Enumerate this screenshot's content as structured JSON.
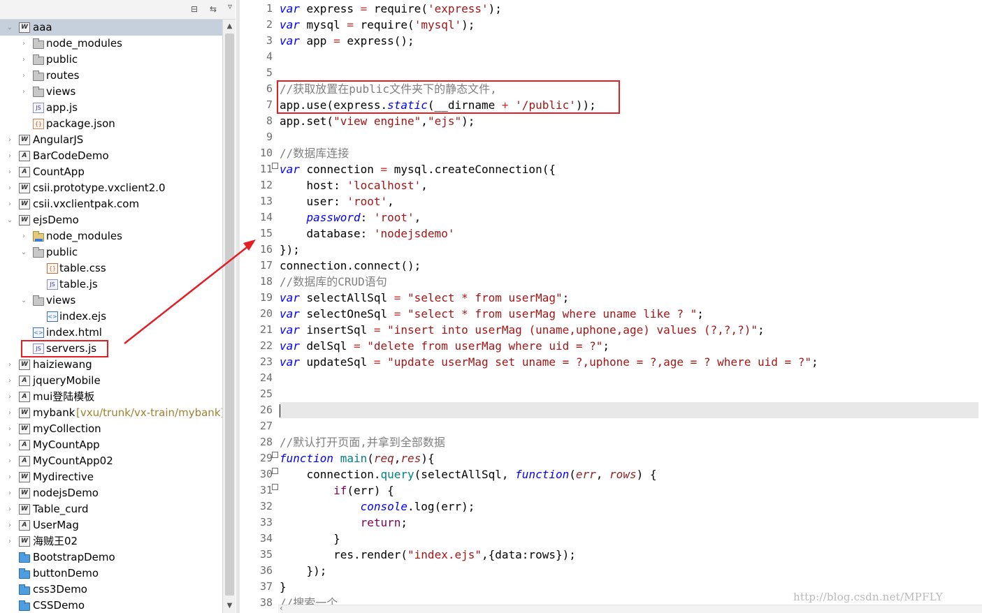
{
  "explorer": {
    "toolbar": {
      "collapse_icon": "collapse-all-icon",
      "link_icon": "link-editor-icon",
      "menu_icon": "view-menu-icon"
    },
    "items": [
      {
        "label": "aaa",
        "icon": "web-project-icon",
        "kind": "proj",
        "glyph": "W",
        "twisty": "▾",
        "level": 0,
        "selected": true
      },
      {
        "label": "node_modules",
        "icon": "folder-icon",
        "kind": "folder",
        "twisty": "›",
        "level": 1
      },
      {
        "label": "public",
        "icon": "folder-icon",
        "kind": "folder",
        "twisty": "›",
        "level": 1
      },
      {
        "label": "routes",
        "icon": "folder-icon",
        "kind": "folder",
        "twisty": "›",
        "level": 1
      },
      {
        "label": "views",
        "icon": "folder-icon",
        "kind": "folder",
        "twisty": "›",
        "level": 1
      },
      {
        "label": "app.js",
        "icon": "js-file-icon",
        "kind": "file",
        "glyph": "JS",
        "level": 1
      },
      {
        "label": "package.json",
        "icon": "json-file-icon",
        "kind": "file-json",
        "glyph": "{}",
        "level": 1
      },
      {
        "label": "AngularJS",
        "icon": "web-project-icon",
        "kind": "proj",
        "glyph": "W",
        "twisty": "›",
        "level": 0
      },
      {
        "label": "BarCodeDemo",
        "icon": "app-project-icon",
        "kind": "proj",
        "glyph": "A",
        "twisty": "›",
        "level": 0
      },
      {
        "label": "CountApp",
        "icon": "app-project-icon",
        "kind": "proj",
        "glyph": "A",
        "twisty": "›",
        "level": 0
      },
      {
        "label": "csii.prototype.vxclient2.0",
        "icon": "web-project-icon",
        "kind": "proj",
        "glyph": "W",
        "twisty": "›",
        "level": 0
      },
      {
        "label": "csii.vxclientpak.com",
        "icon": "web-project-icon",
        "kind": "proj",
        "glyph": "W",
        "twisty": "›",
        "level": 0
      },
      {
        "label": "ejsDemo",
        "icon": "web-project-icon",
        "kind": "proj",
        "glyph": "W",
        "twisty": "▾",
        "level": 0
      },
      {
        "label": "node_modules",
        "icon": "library-folder-icon",
        "kind": "folder-lib",
        "twisty": "›",
        "level": 1
      },
      {
        "label": "public",
        "icon": "open-folder-icon",
        "kind": "folder-open",
        "twisty": "▾",
        "level": 1
      },
      {
        "label": "table.css",
        "icon": "css-file-icon",
        "kind": "file-css",
        "glyph": "{}",
        "level": 2
      },
      {
        "label": "table.js",
        "icon": "js-file-icon",
        "kind": "file",
        "glyph": "JS",
        "level": 2
      },
      {
        "label": "views",
        "icon": "open-folder-icon",
        "kind": "folder-open",
        "twisty": "▾",
        "level": 1
      },
      {
        "label": "index.ejs",
        "icon": "ejs-file-icon",
        "kind": "file-ejs",
        "glyph": "<>",
        "level": 2
      },
      {
        "label": "index.html",
        "icon": "html-file-icon",
        "kind": "file-html",
        "glyph": "<>",
        "level": 1
      },
      {
        "label": "servers.js",
        "icon": "js-file-icon",
        "kind": "file",
        "glyph": "JS",
        "level": 1,
        "highlight": true
      },
      {
        "label": "haiziewang",
        "icon": "web-project-icon",
        "kind": "proj",
        "glyph": "W",
        "twisty": "›",
        "level": 0
      },
      {
        "label": "jqueryMobile",
        "icon": "app-project-icon",
        "kind": "proj",
        "glyph": "A",
        "twisty": "›",
        "level": 0
      },
      {
        "label": "mui登陆模板",
        "icon": "app-project-icon",
        "kind": "proj",
        "glyph": "A",
        "twisty": "›",
        "level": 0
      },
      {
        "label": "mybank",
        "decoration": "[vxu/trunk/vx-train/mybank]",
        "icon": "svn-project-icon",
        "kind": "proj",
        "glyph": "W",
        "twisty": "›",
        "level": 0
      },
      {
        "label": "myCollection",
        "icon": "web-project-icon",
        "kind": "proj",
        "glyph": "W",
        "twisty": "›",
        "level": 0
      },
      {
        "label": "MyCountApp",
        "icon": "app-project-icon",
        "kind": "proj",
        "glyph": "A",
        "twisty": "›",
        "level": 0
      },
      {
        "label": "MyCountApp02",
        "icon": "app-project-icon",
        "kind": "proj",
        "glyph": "A",
        "twisty": "›",
        "level": 0
      },
      {
        "label": "Mydirective",
        "icon": "web-project-icon",
        "kind": "proj",
        "glyph": "W",
        "twisty": "›",
        "level": 0
      },
      {
        "label": "nodejsDemo",
        "icon": "web-project-icon",
        "kind": "proj",
        "glyph": "W",
        "twisty": "›",
        "level": 0
      },
      {
        "label": "Table_curd",
        "icon": "web-project-icon",
        "kind": "proj",
        "glyph": "W",
        "twisty": "›",
        "level": 0
      },
      {
        "label": "UserMag",
        "icon": "app-project-icon",
        "kind": "proj",
        "glyph": "A",
        "twisty": "›",
        "level": 0
      },
      {
        "label": "海贼王02",
        "icon": "web-project-icon",
        "kind": "proj",
        "glyph": "W",
        "twisty": "›",
        "level": 0
      },
      {
        "label": "BootstrapDemo",
        "icon": "blue-folder-icon",
        "kind": "folder-blue",
        "level": 0
      },
      {
        "label": "buttonDemo",
        "icon": "blue-folder-icon",
        "kind": "folder-blue",
        "level": 0
      },
      {
        "label": "css3Demo",
        "icon": "blue-folder-icon",
        "kind": "folder-blue",
        "level": 0
      },
      {
        "label": "CSSDemo",
        "icon": "blue-folder-icon",
        "kind": "folder-blue",
        "level": 0
      }
    ],
    "scroll": {
      "up_icon": "scroll-up-icon",
      "down_icon": "scroll-down-icon"
    }
  },
  "editor": {
    "lines": [
      {
        "n": "1",
        "tokens": [
          [
            "k",
            "var"
          ],
          [
            "m",
            " express "
          ],
          [
            "o",
            "="
          ],
          [
            "m",
            " require("
          ],
          [
            "s",
            "'express'"
          ],
          [
            "m",
            ");"
          ]
        ]
      },
      {
        "n": "2",
        "tokens": [
          [
            "k",
            "var"
          ],
          [
            "m",
            " mysql "
          ],
          [
            "o",
            "="
          ],
          [
            "m",
            " require("
          ],
          [
            "s",
            "'mysql'"
          ],
          [
            "m",
            ");"
          ]
        ]
      },
      {
        "n": "3",
        "tokens": [
          [
            "k",
            "var"
          ],
          [
            "m",
            " app "
          ],
          [
            "o",
            "="
          ],
          [
            "m",
            " express();"
          ]
        ]
      },
      {
        "n": "4",
        "tokens": []
      },
      {
        "n": "5",
        "tokens": []
      },
      {
        "n": "6",
        "tokens": [
          [
            "c",
            "//获取放置在public文件夹下的静态文件,"
          ]
        ]
      },
      {
        "n": "7",
        "tokens": [
          [
            "m",
            "app.use(express."
          ],
          [
            "prop-i",
            "static"
          ],
          [
            "m",
            "(__dirname "
          ],
          [
            "o",
            "+"
          ],
          [
            "m",
            " "
          ],
          [
            "s",
            "'/public'"
          ],
          [
            "m",
            "));"
          ]
        ]
      },
      {
        "n": "8",
        "tokens": [
          [
            "m",
            "app.set("
          ],
          [
            "s",
            "\"view engine\""
          ],
          [
            "m",
            ","
          ],
          [
            "s",
            "\"ejs\""
          ],
          [
            "m",
            ");"
          ]
        ]
      },
      {
        "n": "9",
        "tokens": []
      },
      {
        "n": "10",
        "tokens": [
          [
            "c",
            "//数据库连接"
          ]
        ]
      },
      {
        "n": "11",
        "fold": true,
        "tokens": [
          [
            "k",
            "var"
          ],
          [
            "m",
            " connection "
          ],
          [
            "o",
            "="
          ],
          [
            "m",
            " mysql.createConnection({"
          ]
        ]
      },
      {
        "n": "12",
        "tokens": [
          [
            "m",
            "    host: "
          ],
          [
            "s",
            "'localhost'"
          ],
          [
            "m",
            ","
          ]
        ]
      },
      {
        "n": "13",
        "tokens": [
          [
            "m",
            "    user: "
          ],
          [
            "s",
            "'root'"
          ],
          [
            "m",
            ","
          ]
        ]
      },
      {
        "n": "14",
        "tokens": [
          [
            "m",
            "    "
          ],
          [
            "prop-i",
            "password"
          ],
          [
            "m",
            ": "
          ],
          [
            "s",
            "'root'"
          ],
          [
            "m",
            ","
          ]
        ]
      },
      {
        "n": "15",
        "tokens": [
          [
            "m",
            "    database: "
          ],
          [
            "s",
            "'nodejsdemo'"
          ]
        ]
      },
      {
        "n": "16",
        "tokens": [
          [
            "m",
            "});"
          ]
        ]
      },
      {
        "n": "17",
        "tokens": [
          [
            "m",
            "connection.connect();"
          ]
        ]
      },
      {
        "n": "18",
        "tokens": [
          [
            "c",
            "//数据库的CRUD语句"
          ]
        ]
      },
      {
        "n": "19",
        "tokens": [
          [
            "k",
            "var"
          ],
          [
            "m",
            " selectAllSql "
          ],
          [
            "o",
            "="
          ],
          [
            "m",
            " "
          ],
          [
            "s",
            "\"select * from userMag\""
          ],
          [
            "m",
            ";"
          ]
        ]
      },
      {
        "n": "20",
        "tokens": [
          [
            "k",
            "var"
          ],
          [
            "m",
            " selectOneSql "
          ],
          [
            "o",
            "="
          ],
          [
            "m",
            " "
          ],
          [
            "s",
            "\"select * from userMag where uname like ? \""
          ],
          [
            "m",
            ";"
          ]
        ]
      },
      {
        "n": "21",
        "tokens": [
          [
            "k",
            "var"
          ],
          [
            "m",
            " insertSql "
          ],
          [
            "o",
            "="
          ],
          [
            "m",
            " "
          ],
          [
            "s",
            "\"insert into userMag (uname,uphone,age) values (?,?,?)\""
          ],
          [
            "m",
            ";"
          ]
        ]
      },
      {
        "n": "22",
        "tokens": [
          [
            "k",
            "var"
          ],
          [
            "m",
            " delSql "
          ],
          [
            "o",
            "="
          ],
          [
            "m",
            " "
          ],
          [
            "s",
            "\"delete from userMag where uid = ?\""
          ],
          [
            "m",
            ";"
          ]
        ]
      },
      {
        "n": "23",
        "tokens": [
          [
            "k",
            "var"
          ],
          [
            "m",
            " updateSql "
          ],
          [
            "o",
            "="
          ],
          [
            "m",
            " "
          ],
          [
            "s",
            "\"update userMag set uname = ?,uphone = ?,age = ? where uid = ?\""
          ],
          [
            "m",
            ";"
          ]
        ]
      },
      {
        "n": "24",
        "tokens": []
      },
      {
        "n": "25",
        "tokens": []
      },
      {
        "n": "26",
        "current": true,
        "tokens": []
      },
      {
        "n": "27",
        "tokens": []
      },
      {
        "n": "28",
        "tokens": [
          [
            "c",
            "//默认打开页面,并拿到全部数据"
          ]
        ]
      },
      {
        "n": "29",
        "fold": true,
        "tokens": [
          [
            "k",
            "function"
          ],
          [
            "m",
            " "
          ],
          [
            "fn",
            "main"
          ],
          [
            "m",
            "("
          ],
          [
            "it-p",
            "req"
          ],
          [
            "m",
            ","
          ],
          [
            "it-p",
            "res"
          ],
          [
            "m",
            "){"
          ]
        ]
      },
      {
        "n": "30",
        "fold": true,
        "tokens": [
          [
            "m",
            "    connection."
          ],
          [
            "fn",
            "query"
          ],
          [
            "m",
            "(selectAllSql, "
          ],
          [
            "k",
            "function"
          ],
          [
            "m",
            "("
          ],
          [
            "it-p",
            "err"
          ],
          [
            "m",
            ", "
          ],
          [
            "it-p",
            "rows"
          ],
          [
            "m",
            ") {"
          ]
        ]
      },
      {
        "n": "31",
        "fold": true,
        "tokens": [
          [
            "m",
            "        "
          ],
          [
            "ret",
            "if"
          ],
          [
            "m",
            "(err) {"
          ]
        ]
      },
      {
        "n": "32",
        "tokens": [
          [
            "m",
            "            "
          ],
          [
            "prop-i",
            "console"
          ],
          [
            "m",
            ".log(err);"
          ]
        ]
      },
      {
        "n": "33",
        "tokens": [
          [
            "m",
            "            "
          ],
          [
            "ret",
            "return"
          ],
          [
            "m",
            ";"
          ]
        ]
      },
      {
        "n": "34",
        "tokens": [
          [
            "m",
            "        }"
          ]
        ]
      },
      {
        "n": "35",
        "tokens": [
          [
            "m",
            "        res.render("
          ],
          [
            "s",
            "\"index.ejs\""
          ],
          [
            "m",
            ",{data:rows});"
          ]
        ]
      },
      {
        "n": "36",
        "tokens": [
          [
            "m",
            "    });"
          ]
        ]
      },
      {
        "n": "37",
        "tokens": [
          [
            "m",
            "}"
          ]
        ]
      },
      {
        "n": "38",
        "tokens": [
          [
            "c",
            "//搜索一个"
          ]
        ]
      }
    ]
  },
  "watermark": "http://blog.csdn.net/MPFLY",
  "colors": {
    "annotation": "#e31e24",
    "selection": "#c6cfdc",
    "current_line": "#e8e8e8"
  }
}
